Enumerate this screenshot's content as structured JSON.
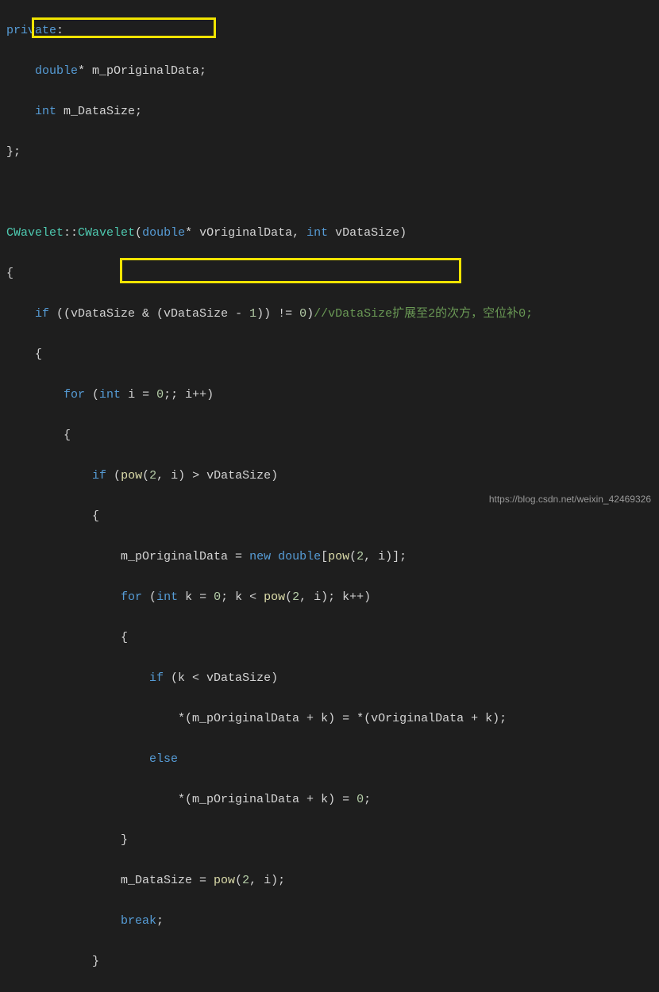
{
  "code": {
    "l1a": "private",
    "l1b": ":",
    "l2a": "    ",
    "l2b": "double",
    "l2c": "* m_pOriginalData;",
    "l3a": "    ",
    "l3b": "int",
    "l3c": " m_DataSize;",
    "l4": "};",
    "l6a": "CWavelet",
    "l6b": "::",
    "l6c": "CWavelet",
    "l6d": "(",
    "l6e": "double",
    "l6f": "* vOriginalData, ",
    "l6g": "int",
    "l6h": " vDataSize)",
    "l7": "{",
    "l8a": "    ",
    "l8b": "if",
    "l8c": " ((vDataSize & (vDataSize - ",
    "l8d": "1",
    "l8e": ")) != ",
    "l8f": "0",
    "l8g": ")",
    "l8h": "//vDataSize扩展至2的次方，空位补0;",
    "l9": "    {",
    "l10a": "        ",
    "l10b": "for",
    "l10c": " (",
    "l10d": "int",
    "l10e": " i = ",
    "l10f": "0",
    "l10g": ";; i++)",
    "l11": "        {",
    "l12a": "            ",
    "l12b": "if",
    "l12c": " (",
    "l12d": "pow",
    "l12e": "(",
    "l12f": "2",
    "l12g": ", i) > vDataSize)",
    "l13": "            {",
    "l14a": "                m_pOriginalData = ",
    "l14b": "new",
    "l14c": " ",
    "l14d": "double",
    "l14e": "[",
    "l14f": "pow",
    "l14g": "(",
    "l14h": "2",
    "l14i": ", i)];",
    "l15a": "                ",
    "l15b": "for",
    "l15c": " (",
    "l15d": "int",
    "l15e": " k = ",
    "l15f": "0",
    "l15g": "; k < ",
    "l15h": "pow",
    "l15i": "(",
    "l15j": "2",
    "l15k": ", i); k++)",
    "l16": "                {",
    "l17a": "                    ",
    "l17b": "if",
    "l17c": " (k < vDataSize)",
    "l18": "                        *(m_pOriginalData + k) = *(vOriginalData + k);",
    "l19a": "                    ",
    "l19b": "else",
    "l20a": "                        *(m_pOriginalData + k) = ",
    "l20b": "0",
    "l20c": ";",
    "l21": "                }",
    "l22a": "                m_DataSize = ",
    "l22b": "pow",
    "l22c": "(",
    "l22d": "2",
    "l22e": ", i);",
    "l23a": "                ",
    "l23b": "break",
    "l23c": ";",
    "l24": "            }"
  },
  "watermark": "https://blog.csdn.net/weixin_42469326"
}
